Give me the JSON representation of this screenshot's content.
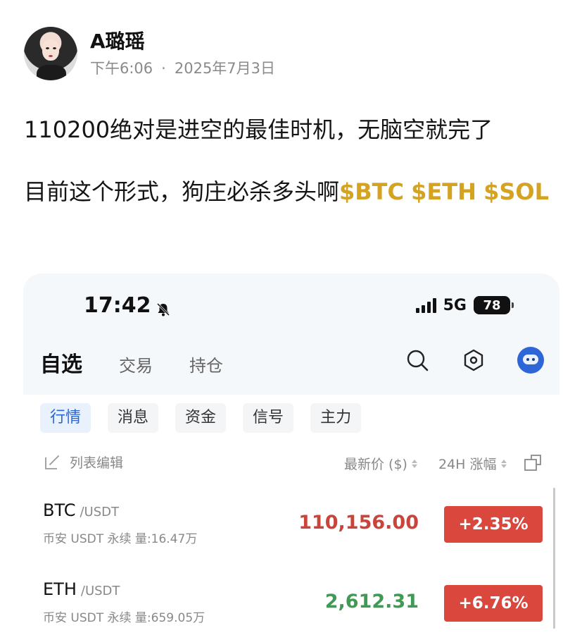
{
  "post": {
    "author": "A璐瑶",
    "time": "下午6:06",
    "separator": "·",
    "date": "2025年7月3日",
    "line1": "110200绝对是进空的最佳时机，无脑空就完了",
    "line2_text": "目前这个形式，狗庄必杀多头啊",
    "tickers": [
      "$BTC",
      "$ETH",
      "$SOL"
    ]
  },
  "phone": {
    "time": "17:42",
    "network": "5G",
    "battery": "78",
    "top_tabs": [
      "自选",
      "交易",
      "持仓"
    ],
    "sub_tabs": [
      "行情",
      "消息",
      "资金",
      "信号",
      "主力"
    ],
    "list_edit_label": "列表编辑",
    "col_price": "最新价 ($)",
    "col_change": "24H 涨幅",
    "rows": [
      {
        "symbol": "BTC",
        "pair": "/USDT",
        "info": "币安 USDT 永续  量:16.47万",
        "price": "110,156.00",
        "change": "+2.35%"
      },
      {
        "symbol": "ETH",
        "pair": "/USDT",
        "info": "币安 USDT 永续  量:659.05万",
        "price": "2,612.31",
        "change": "+6.76%"
      }
    ]
  },
  "colors": {
    "ticker": "#d4a321",
    "change_bg": "#d9473d",
    "price_red": "#c9453b",
    "price_green": "#3f9a54",
    "active_tab": "#2b66d9"
  }
}
